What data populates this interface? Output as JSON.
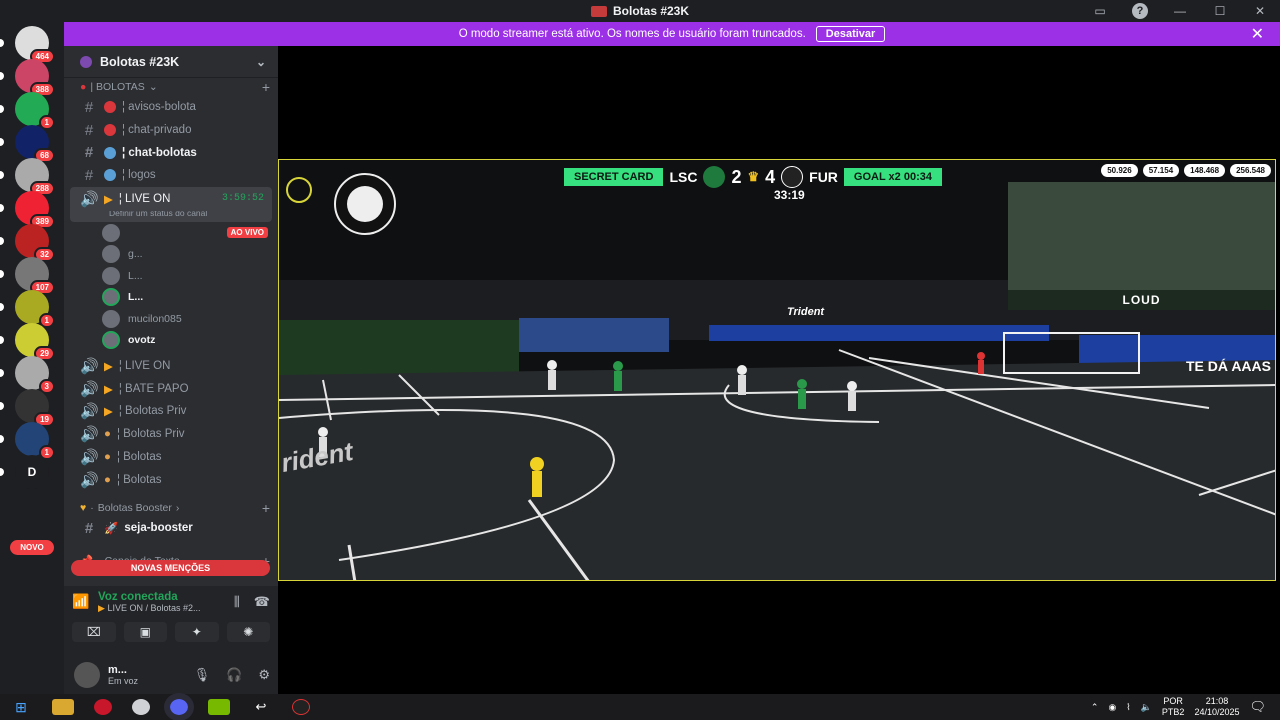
{
  "window": {
    "title": "Bolotas #23K",
    "help_icon": "?"
  },
  "banner": {
    "text": "O modo streamer está ativo. Os nomes de usuário foram truncados.",
    "button": "Desativar"
  },
  "guild_badges": [
    "464",
    "388",
    "1",
    "68",
    "288",
    "389",
    "32",
    "107",
    "1",
    "29",
    "3",
    "19",
    "1",
    "D"
  ],
  "guild_novo": "NOVO",
  "server": {
    "name": "Bolotas #23K"
  },
  "categories": {
    "bolotas": "| BOLOTAS",
    "booster": "Bolotas Booster",
    "texto": "Canais de Texto"
  },
  "channels": {
    "text1": [
      {
        "name": "avisos-bolota",
        "color": "#da373c"
      },
      {
        "name": "chat-privado",
        "color": "#da373c"
      },
      {
        "name": "chat-bolotas",
        "color": "#5aa0d6",
        "active": true
      },
      {
        "name": "logos",
        "color": "#5aa0d6"
      }
    ],
    "live": {
      "name": "LIVE ON",
      "timer": "3:59:52",
      "status": "Definir um status do canal"
    },
    "voice_users": [
      {
        "name": "",
        "live": "AO VIVO"
      },
      {
        "name": "g..."
      },
      {
        "name": "L..."
      },
      {
        "name": "L..."
      },
      {
        "name": "mucilon085"
      },
      {
        "name": "ovotz"
      }
    ],
    "voice": [
      {
        "name": "LIVE ON"
      },
      {
        "name": "BATE PAPO"
      },
      {
        "name": "Bolotas Priv"
      },
      {
        "name": "Bolotas Priv"
      },
      {
        "name": "Bolotas"
      },
      {
        "name": "Bolotas"
      }
    ],
    "booster_channel": "seja-booster"
  },
  "mentions": "NOVAS MENÇÕES",
  "voice_panel": {
    "title": "Voz conectada",
    "sub": "LIVE ON / Bolotas #2..."
  },
  "user": {
    "name": "m...",
    "status": "Em voz"
  },
  "stream": {
    "tag_left": "SECRET CARD",
    "team_home": "LSC",
    "score_home": "2",
    "score_away": "4",
    "team_away": "FUR",
    "tag_right": "GOAL x2",
    "tag_right_time": "00:34",
    "clock": "33:19",
    "stats": [
      "50.926",
      "57.154",
      "148.468",
      "256.548"
    ],
    "loud": "LOUD",
    "board_text_1": "Trident",
    "board_text_2": "TE DÁ AAAS",
    "court_text": "rident"
  },
  "taskbar": {
    "lang1": "POR",
    "lang2": "PTB2",
    "time": "21:08",
    "date": "24/10/2025"
  }
}
